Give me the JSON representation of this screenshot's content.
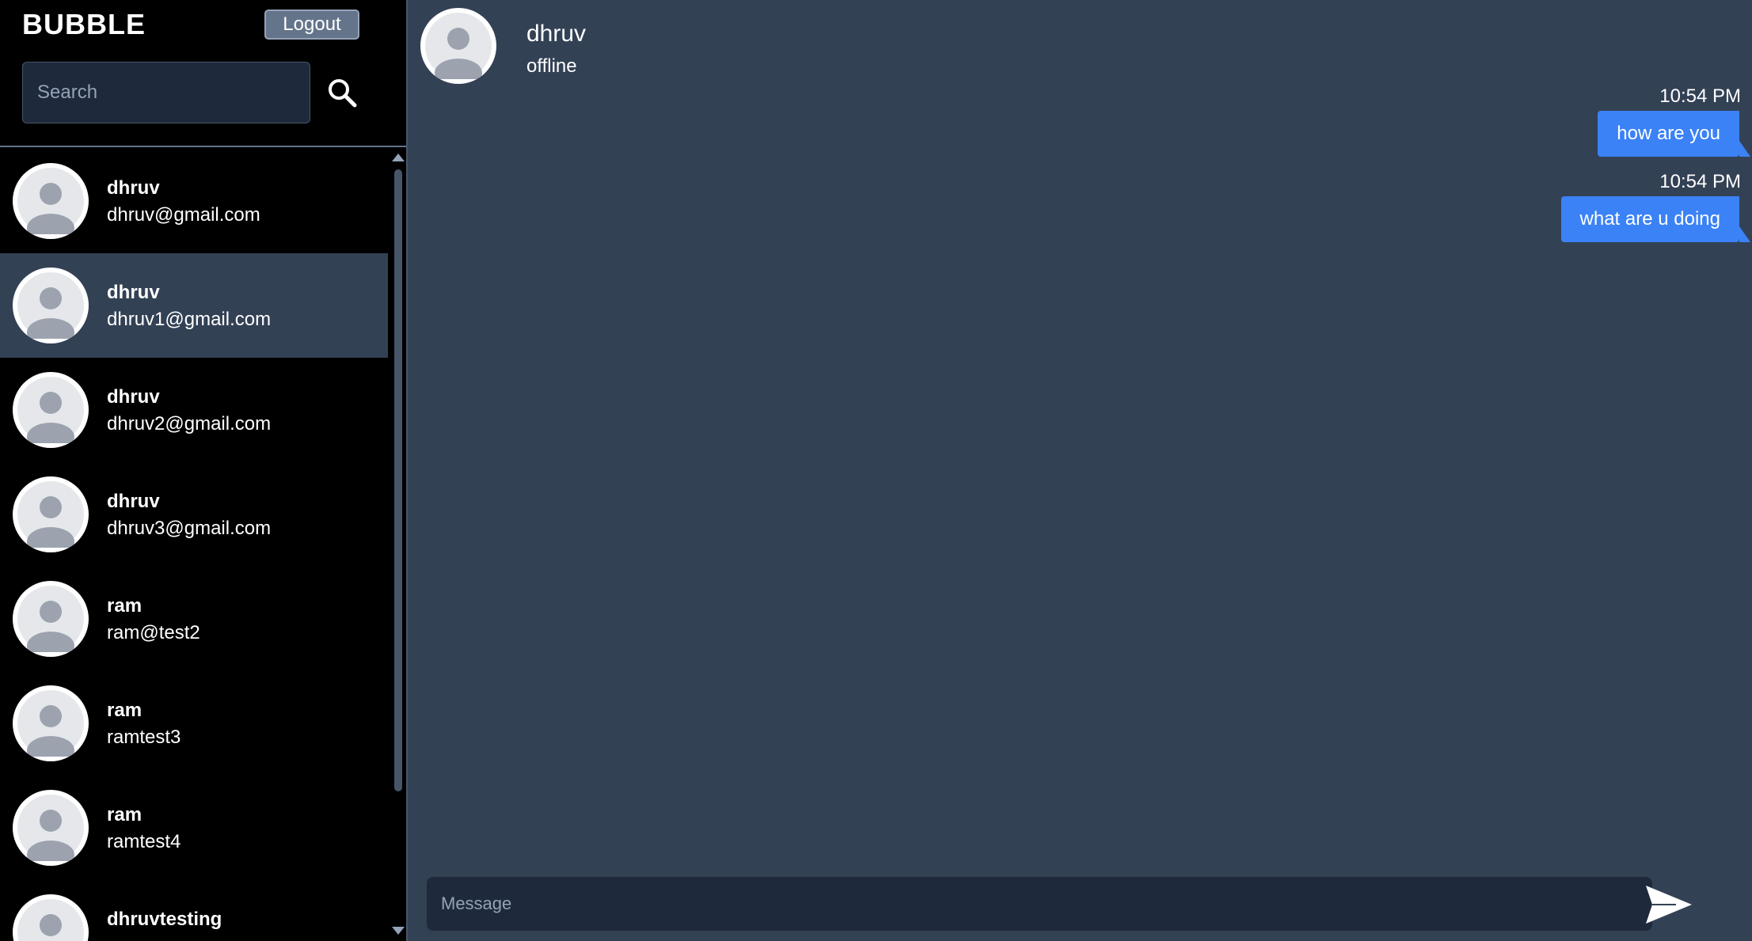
{
  "sidebar": {
    "brand": "BUBBLE",
    "logout_label": "Logout",
    "search_placeholder": "Search",
    "contacts": [
      {
        "name": "dhruv",
        "email": "dhruv@gmail.com",
        "active": false
      },
      {
        "name": "dhruv",
        "email": "dhruv1@gmail.com",
        "active": true
      },
      {
        "name": "dhruv",
        "email": "dhruv2@gmail.com",
        "active": false
      },
      {
        "name": "dhruv",
        "email": "dhruv3@gmail.com",
        "active": false
      },
      {
        "name": "ram",
        "email": "ram@test2",
        "active": false
      },
      {
        "name": "ram",
        "email": "ramtest3",
        "active": false
      },
      {
        "name": "ram",
        "email": "ramtest4",
        "active": false
      },
      {
        "name": "dhruvtesting",
        "email": "",
        "active": false
      }
    ]
  },
  "chat": {
    "contact_name": "dhruv",
    "contact_status": "offline",
    "messages": [
      {
        "time": "10:54 PM",
        "text": "how are you"
      },
      {
        "time": "10:54 PM",
        "text": "what are u doing"
      }
    ],
    "message_placeholder": "Message"
  },
  "colors": {
    "accent": "#3b82f6",
    "sidebar_bg": "#000000",
    "chat_bg": "#334155",
    "input_bg": "#1e293b"
  },
  "icons": {
    "search": "search-icon",
    "send": "send-icon",
    "avatar": "avatar-icon"
  }
}
